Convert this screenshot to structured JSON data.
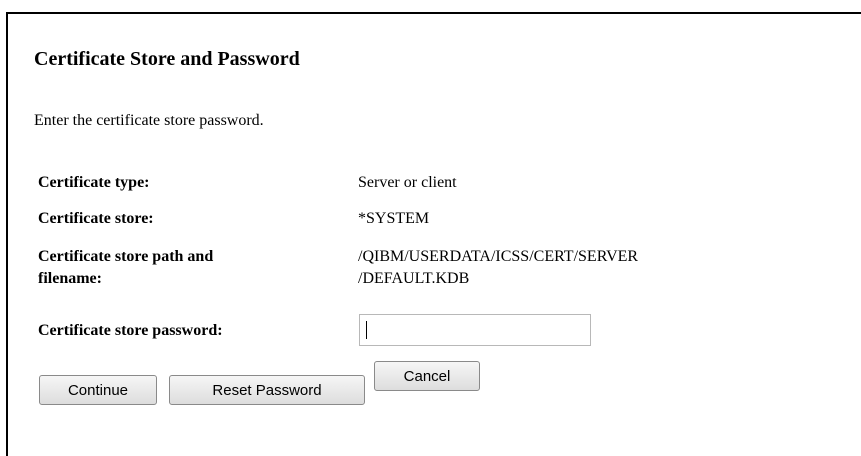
{
  "page": {
    "title": "Certificate Store and Password",
    "intro": "Enter the certificate store password."
  },
  "fields": {
    "type": {
      "label": "Certificate type:",
      "value": "Server or client"
    },
    "store": {
      "label": "Certificate store:",
      "value": "*SYSTEM"
    },
    "path": {
      "label_line1": "Certificate store path and",
      "label_line2": "filename:",
      "value_line1": "/QIBM/USERDATA/ICSS/CERT/SERVER",
      "value_line2": "/DEFAULT.KDB"
    },
    "password": {
      "label": "Certificate store password:",
      "value": ""
    }
  },
  "buttons": {
    "continue": "Continue",
    "reset": "Reset Password",
    "cancel": "Cancel"
  }
}
